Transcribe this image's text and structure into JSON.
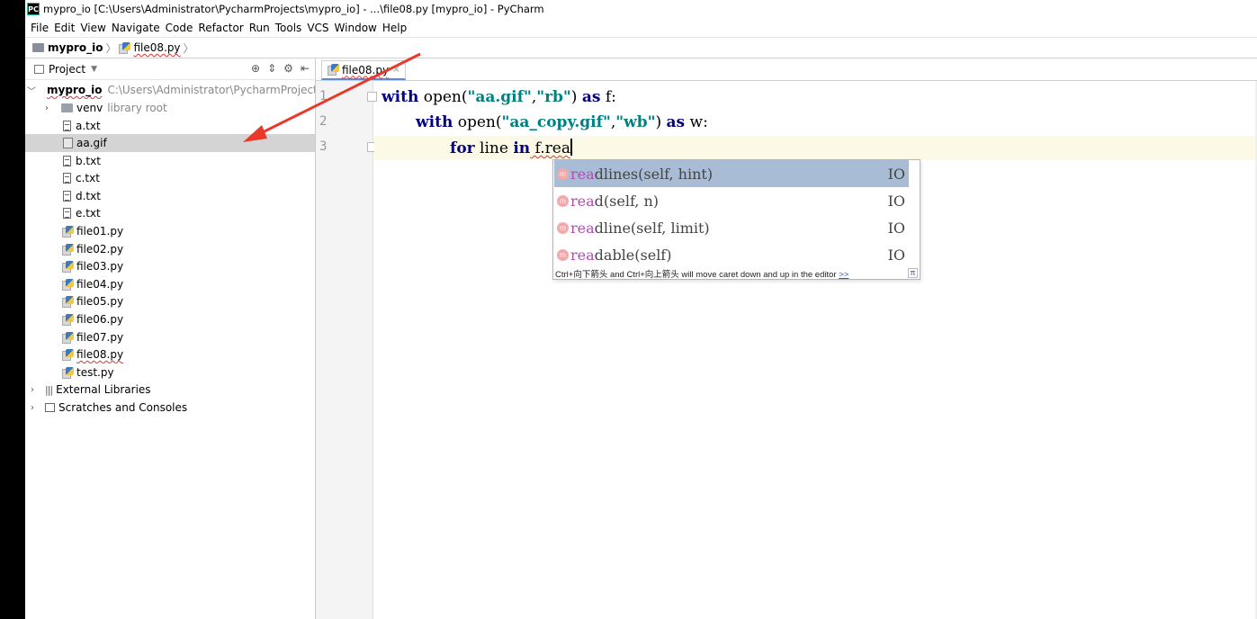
{
  "window": {
    "title": "mypro_io [C:\\Users\\Administrator\\PycharmProjects\\mypro_io] - ...\\file08.py [mypro_io] - PyCharm",
    "logo": "PC"
  },
  "menu": [
    "File",
    "Edit",
    "View",
    "Navigate",
    "Code",
    "Refactor",
    "Run",
    "Tools",
    "VCS",
    "Window",
    "Help"
  ],
  "breadcrumb": {
    "project": "mypro_io",
    "file": "file08.py"
  },
  "project_panel": {
    "title": "Project",
    "root": {
      "name": "mypro_io",
      "path": "C:\\Users\\Administrator\\PycharmProjects\\r"
    },
    "venv": {
      "name": "venv",
      "note": "library root"
    },
    "files": [
      "a.txt",
      "aa.gif",
      "b.txt",
      "c.txt",
      "d.txt",
      "e.txt",
      "file01.py",
      "file02.py",
      "file03.py",
      "file04.py",
      "file05.py",
      "file06.py",
      "file07.py",
      "file08.py",
      "test.py"
    ],
    "selected": "aa.gif",
    "external": "External Libraries",
    "scratches": "Scratches and Consoles"
  },
  "editor": {
    "tab": "file08.py",
    "line_numbers": [
      "1",
      "2",
      "3"
    ],
    "lines": [
      {
        "kw1": "with",
        "t1": " open(",
        "s1": "\"aa.gif\"",
        "t2": ",",
        "s2": "\"rb\"",
        "t3": ") ",
        "kw2": "as",
        "t4": " f:"
      },
      {
        "kw1": "with",
        "t1": " open(",
        "s1": "\"aa_copy.gif\"",
        "t2": ",",
        "s2": "\"wb\"",
        "t3": ") ",
        "kw2": "as",
        "t4": " w:"
      },
      {
        "kw1": "for",
        "t1": " line ",
        "kw2": "in",
        "t2": " f.rea"
      }
    ]
  },
  "completion": {
    "items": [
      {
        "match": "rea",
        "rest": "dlines(self, hint)",
        "type": "IO"
      },
      {
        "match": "rea",
        "rest": "d(self, n)",
        "type": "IO"
      },
      {
        "match": "rea",
        "rest": "dline(self, limit)",
        "type": "IO"
      },
      {
        "match": "rea",
        "rest": "dable(self)",
        "type": "IO"
      }
    ],
    "hint": "Ctrl+向下箭头 and Ctrl+向上箭头 will move caret down and up in the editor",
    "hint_link": ">>",
    "pi": "π"
  },
  "colors": {
    "annotation_arrow": "#e8392b",
    "selection": "#a8bcd6",
    "keyword": "#000080",
    "string": "#008080"
  }
}
